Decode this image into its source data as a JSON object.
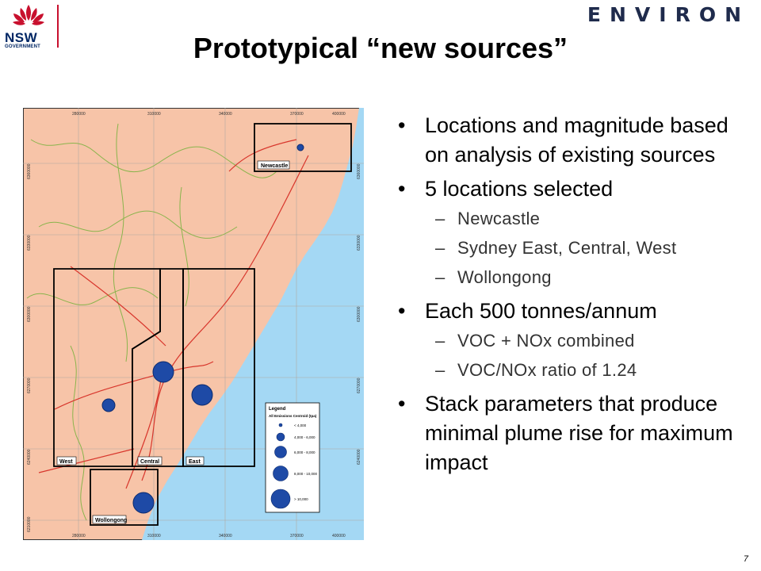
{
  "header": {
    "logo_text": "NSW",
    "logo_subtext": "GOVERNMENT",
    "brand": "ENVIRON"
  },
  "title": "Prototypical “new sources”",
  "map": {
    "region_labels": [
      "Newcastle",
      "West",
      "Central",
      "East",
      "Wollongong"
    ],
    "easting_ticks": [
      "280000",
      "310000",
      "340000",
      "370000",
      "400000"
    ],
    "northing_ticks": [
      "6360000",
      "6330000",
      "6300000",
      "6270000",
      "6240000",
      "6210000"
    ],
    "legend": {
      "title": "Legend",
      "subtitle": "All Emissions Centroid (tpa)",
      "items": [
        "< 4,000",
        "4,000 - 6,000",
        "6,000 - 8,000",
        "8,000 - 10,000",
        "> 10,000"
      ]
    },
    "colors": {
      "land": "#f7c4a8",
      "sea": "#a4d8f4",
      "roads": "#d8362c",
      "boundary": "#8ab44c",
      "sources": "#1e4aa6"
    }
  },
  "bullets": [
    {
      "text": "Locations and magnitude based on analysis of existing sources",
      "sub": []
    },
    {
      "text": "5 locations selected",
      "sub": [
        "Newcastle",
        "Sydney East, Central, West",
        "Wollongong"
      ]
    },
    {
      "text": "Each 500 tonnes/annum",
      "sub": [
        "VOC + NOx combined",
        "VOC/NOx ratio of 1.24"
      ]
    },
    {
      "text": "Stack parameters that produce minimal plume rise for maximum impact",
      "sub": []
    }
  ],
  "page_number": "7"
}
